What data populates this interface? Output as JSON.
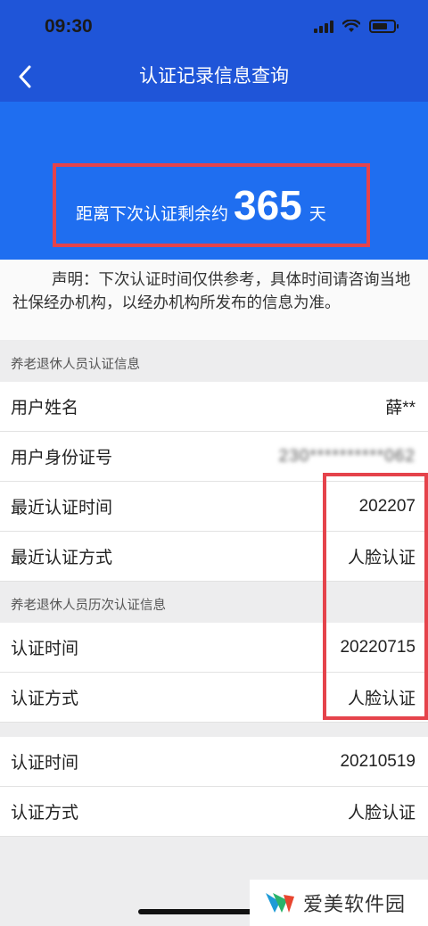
{
  "status_bar": {
    "time": "09:30"
  },
  "nav": {
    "title": "认证记录信息查询"
  },
  "hero": {
    "prefix": "距离下次认证剩余约",
    "days": "365",
    "unit": "天"
  },
  "notice": {
    "text": "声明：下次认证时间仅供参考，具体时间请咨询当地社保经办机构，以经办机构所发布的信息为准。"
  },
  "section_info": {
    "title": "养老退休人员认证信息",
    "rows": [
      {
        "label": "用户姓名",
        "value": "薛**"
      },
      {
        "label": "用户身份证号",
        "value": "230**********062"
      },
      {
        "label": "最近认证时间",
        "value": "202207"
      },
      {
        "label": "最近认证方式",
        "value": "人脸认证"
      }
    ]
  },
  "section_history": {
    "title": "养老退休人员历次认证信息",
    "records": [
      {
        "time_label": "认证时间",
        "time_value": "20220715",
        "method_label": "认证方式",
        "method_value": "人脸认证"
      },
      {
        "time_label": "认证时间",
        "time_value": "20210519",
        "method_label": "认证方式",
        "method_value": "人脸认证"
      }
    ]
  },
  "watermark": {
    "text": "爱美软件园"
  }
}
